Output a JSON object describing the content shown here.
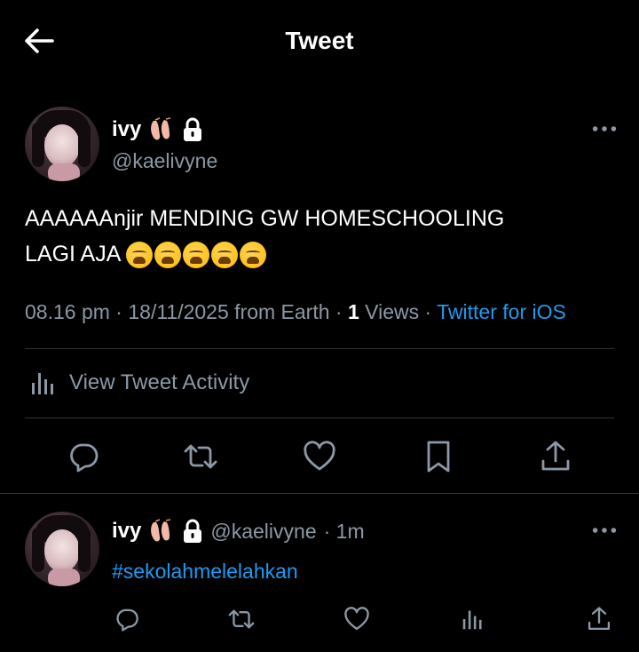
{
  "header": {
    "title": "Tweet",
    "back_icon": "back-arrow-icon"
  },
  "tweet": {
    "author": {
      "name": "ivy",
      "handle": "@kaelivyne",
      "badges": [
        "ballet-shoes-icon",
        "lock-icon"
      ]
    },
    "text_line1": "AAAAAAnjir MENDING GW HOMESCHOOLING",
    "text_line2": "LAGI AJA",
    "emojis": [
      "weary-face-emoji",
      "weary-face-emoji",
      "weary-face-emoji",
      "weary-face-emoji",
      "weary-face-emoji"
    ],
    "meta": {
      "time": "08.16 pm",
      "sep1": "·",
      "date_location": "18/11/2025 from Earth",
      "sep2": "·",
      "views_count": "1",
      "views_label": "Views",
      "sep3": "·",
      "source": "Twitter for iOS"
    },
    "activity_label": "View Tweet Activity",
    "actions": [
      "reply-icon",
      "retweet-icon",
      "like-icon",
      "bookmark-icon",
      "share-icon"
    ]
  },
  "reply": {
    "author": {
      "name": "ivy",
      "handle": "@kaelivyne",
      "time": "· 1m"
    },
    "hashtag": "#sekolahmelelahkan",
    "actions": [
      "reply-icon",
      "retweet-icon",
      "like-icon",
      "views-icon",
      "share-icon"
    ]
  },
  "colors": {
    "background": "#000000",
    "text": "#ffffff",
    "muted": "#8b98a5",
    "link": "#1d9bf0",
    "divider": "#2f3336"
  }
}
